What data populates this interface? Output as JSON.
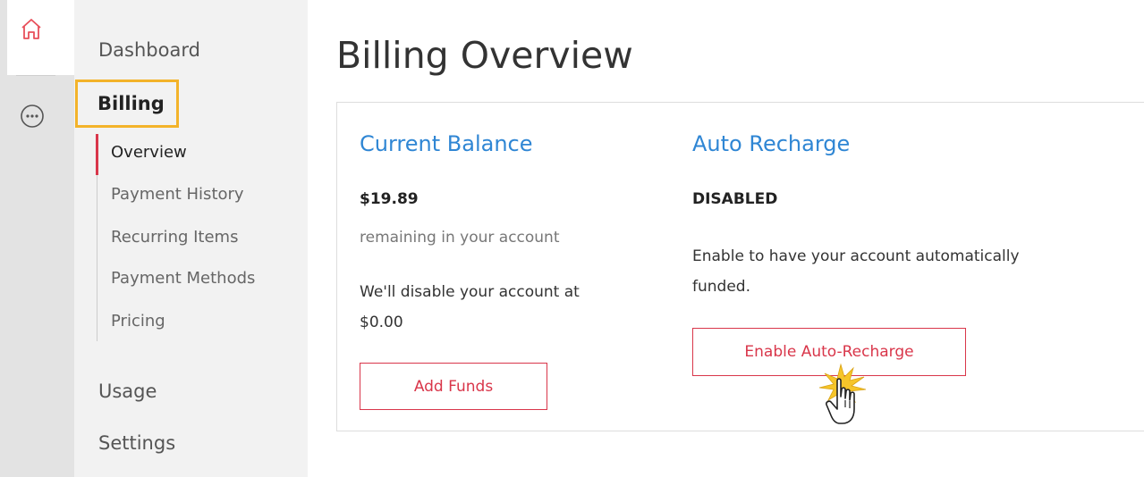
{
  "colors": {
    "accent_red": "#d9364a",
    "link_blue": "#2f86d4",
    "highlight_yellow": "#f3b32a"
  },
  "rail": {
    "icons": [
      "home-icon",
      "more-icon"
    ]
  },
  "nav": {
    "dashboard": "Dashboard",
    "billing": "Billing",
    "sub_items": [
      {
        "label": "Overview",
        "active": true
      },
      {
        "label": "Payment History",
        "active": false
      },
      {
        "label": "Recurring Items",
        "active": false
      },
      {
        "label": "Payment Methods",
        "active": false
      },
      {
        "label": "Pricing",
        "active": false
      }
    ],
    "usage": "Usage",
    "settings": "Settings"
  },
  "main": {
    "title": "Billing Overview",
    "balance": {
      "heading": "Current Balance",
      "amount": "$19.89",
      "caption": "remaining in your account",
      "note_line1": "We'll disable your account at",
      "note_line2": "$0.00",
      "button": "Add Funds"
    },
    "recharge": {
      "heading": "Auto Recharge",
      "status": "DISABLED",
      "description_line1": "Enable to have your account automatically",
      "description_line2": "funded.",
      "button": "Enable Auto-Recharge"
    }
  }
}
